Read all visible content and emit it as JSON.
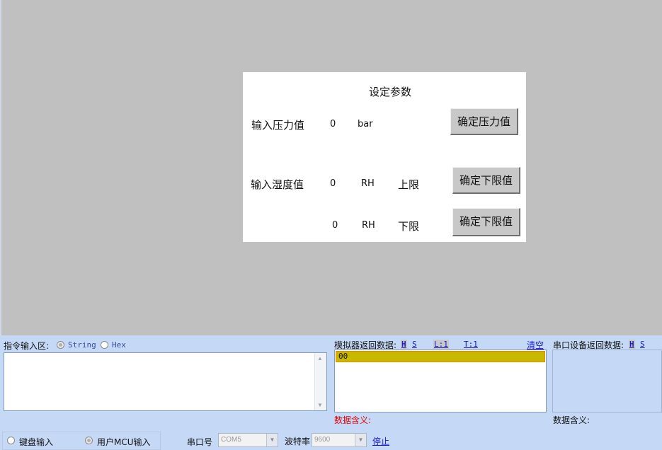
{
  "panel": {
    "title": "设定参数",
    "pressure": {
      "label": "输入压力值",
      "value": "0",
      "unit": "bar",
      "button": "确定压力值"
    },
    "humidity_upper": {
      "label": "输入湿度值",
      "value": "0",
      "unit": "RH",
      "limit": "上限",
      "button": "确定下限值"
    },
    "humidity_lower": {
      "value": "0",
      "unit": "RH",
      "limit": "下限",
      "button": "确定下限值"
    }
  },
  "cmd": {
    "label": "指令输入区:",
    "opt_string": "String",
    "opt_hex": "Hex"
  },
  "sim": {
    "label": "模拟器返回数据:",
    "h": "H",
    "s": "S",
    "l": "L:1",
    "t": "T:1",
    "clear": "清空",
    "data": "00",
    "meaning": "数据含义:"
  },
  "serialdev": {
    "label": "串口设备返回数据:",
    "h": "H",
    "s": "S",
    "meaning": "数据含义:"
  },
  "footer": {
    "keyboard": "键盘输入",
    "mcu": "用户MCU输入",
    "port_label": "串口号",
    "port_value": "COM5",
    "baud_label": "波特率",
    "baud_value": "9600",
    "stop": "停止"
  },
  "colors": {
    "sim_highlight": "#c8b800",
    "meaning_red": "#e00000",
    "bottom_bg": "#c5d8f5"
  }
}
